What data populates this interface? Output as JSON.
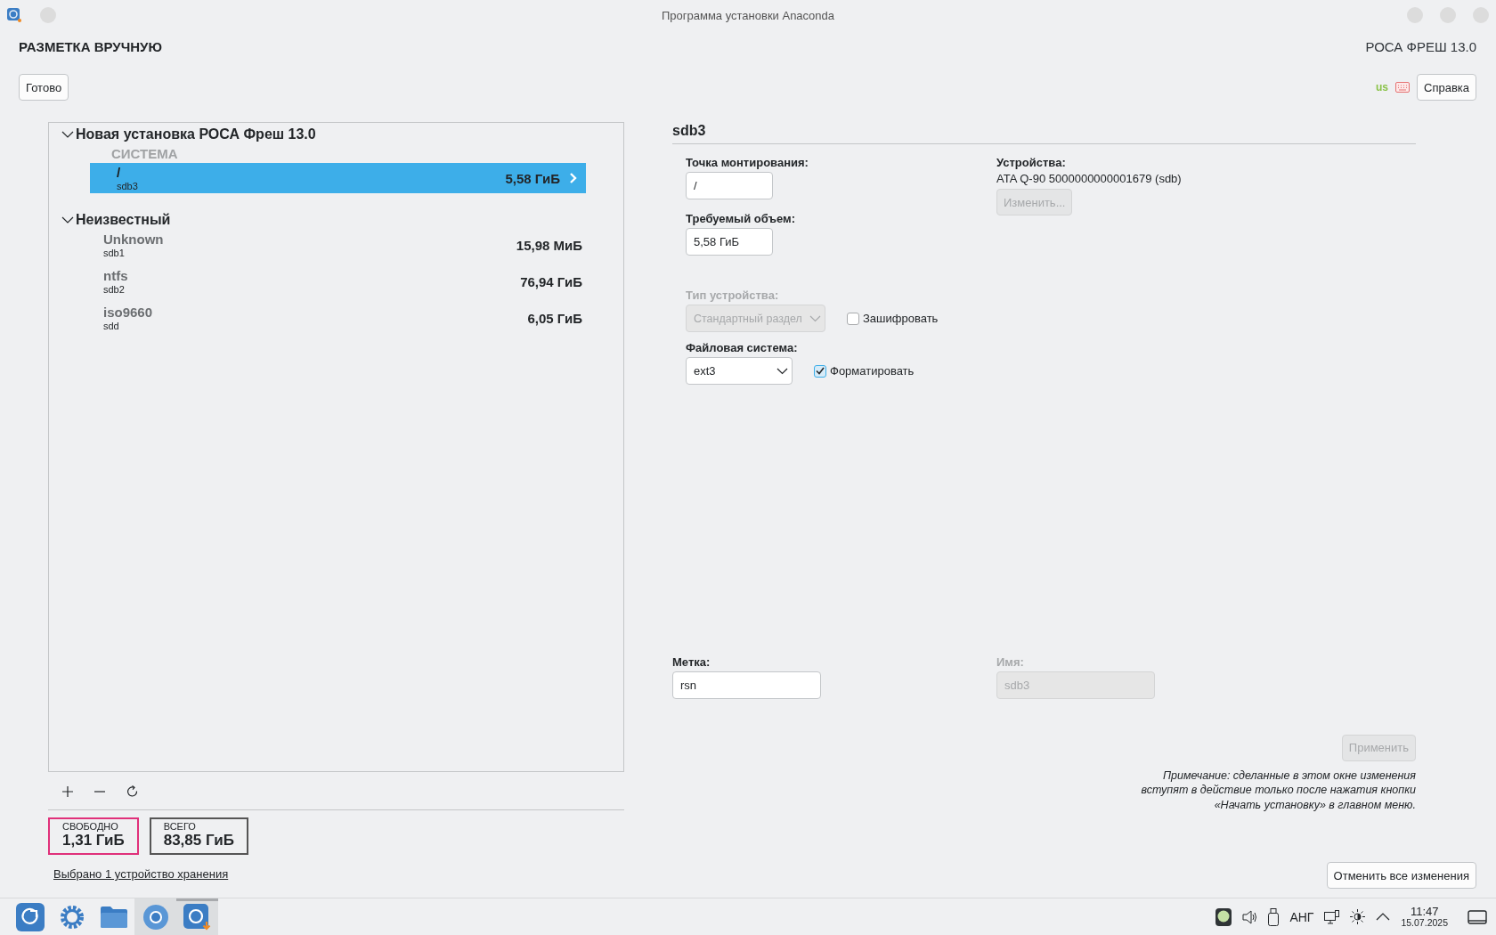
{
  "window": {
    "title": "Программа установки Anaconda"
  },
  "header": {
    "title": "РАЗМЕТКА ВРУЧНУЮ",
    "product": "РОСА ФРЕШ 13.0",
    "done_button": "Готово",
    "keyboard_layout": "us",
    "help_button": "Справка"
  },
  "tree": {
    "groups": [
      {
        "label": "Новая установка РОСА Фреш 13.0",
        "expanded": true,
        "children": [
          {
            "kind": "section",
            "label": "СИСТЕМА"
          },
          {
            "kind": "partition",
            "name": "/",
            "device": "sdb3",
            "size": "5,58 ГиБ",
            "selected": true
          }
        ]
      },
      {
        "label": "Неизвестный",
        "expanded": true,
        "children": [
          {
            "kind": "partition",
            "name": "Unknown",
            "device": "sdb1",
            "size": "15,98 МиБ",
            "selected": false
          },
          {
            "kind": "partition",
            "name": "ntfs",
            "device": "sdb2",
            "size": "76,94 ГиБ",
            "selected": false
          },
          {
            "kind": "partition",
            "name": "iso9660",
            "device": "sdd",
            "size": "6,05 ГиБ",
            "selected": false
          }
        ]
      }
    ]
  },
  "summary": {
    "free_label": "СВОБОДНО",
    "free": "1,31 ГиБ",
    "total_label": "ВСЕГО",
    "total": "83,85 ГиБ",
    "storage_link": "Выбрано 1 устройство хранения"
  },
  "details": {
    "title": "sdb3",
    "mount_point": {
      "label": "Точка монтирования:",
      "value": "/"
    },
    "capacity": {
      "label": "Требуемый объем:",
      "value": "5,58 ГиБ"
    },
    "devices": {
      "label": "Устройства:",
      "value": "ATA Q-90 5000000000001679 (sdb)",
      "modify_button": "Изменить...",
      "modify_disabled": true
    },
    "device_type": {
      "label": "Тип устройства:",
      "value": "Стандартный раздел",
      "disabled": true
    },
    "encrypt": {
      "label": "Зашифровать",
      "checked": false
    },
    "file_system": {
      "label": "Файловая система:",
      "value": "ext3"
    },
    "format": {
      "label": "Форматировать",
      "checked": true
    },
    "label_field": {
      "label": "Метка:",
      "value": "rsn"
    },
    "name_field": {
      "label": "Имя:",
      "value": "sdb3",
      "disabled": true
    },
    "apply_button": {
      "label": "Применить",
      "disabled": true
    },
    "note": "Примечание:  сделанные в этом окне изменения вступят в действие только после нажатия кнопки «Начать установку» в главном меню.",
    "reset_button": "Отменить все изменения"
  },
  "taskbar": {
    "apps": [
      {
        "kind": "launcher",
        "active": false
      },
      {
        "kind": "settings",
        "active": false
      },
      {
        "kind": "files",
        "active": false
      },
      {
        "kind": "browser",
        "active": true
      },
      {
        "kind": "installer",
        "active": true
      }
    ],
    "keyboard_layout": "АНГ",
    "time": "11:47",
    "date": "15.07.2025"
  }
}
